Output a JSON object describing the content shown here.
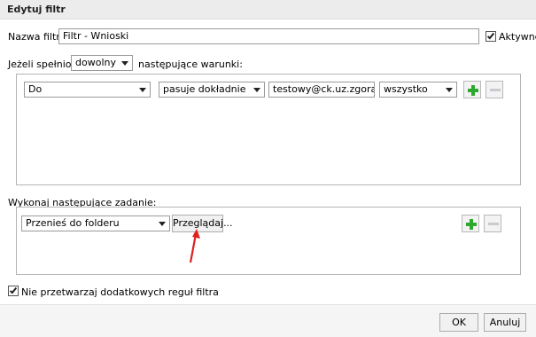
{
  "dialog": {
    "title": "Edytuj filtr"
  },
  "filter": {
    "name_label": "Nazwa filtru:",
    "name_value": "Filtr - Wnioski",
    "active_label": "Aktywne",
    "active_checked": true
  },
  "conditions": {
    "prefix_label": "Jeżeli spełniono",
    "match_mode": "dowolny",
    "suffix_label": "następujące warunki:",
    "rows": [
      {
        "field": "Do",
        "operator": "pasuje dokładnie",
        "value": "testowy@ck.uz.zgora.pl",
        "scope": "wszystko"
      }
    ]
  },
  "actions": {
    "label": "Wykonaj następujące zadanie:",
    "rows": [
      {
        "action": "Przenieś do folderu",
        "browse_label": "Przeglądaj..."
      }
    ]
  },
  "options": {
    "no_more_rules_label": "Nie przetwarzaj dodatkowych reguł filtra",
    "no_more_rules_checked": true
  },
  "buttons": {
    "ok": "OK",
    "cancel": "Anuluj"
  },
  "icons": {
    "add": "plus-icon",
    "remove": "minus-icon"
  },
  "colors": {
    "add_green": "#2fa82f",
    "annotation_arrow": "#e02020"
  }
}
